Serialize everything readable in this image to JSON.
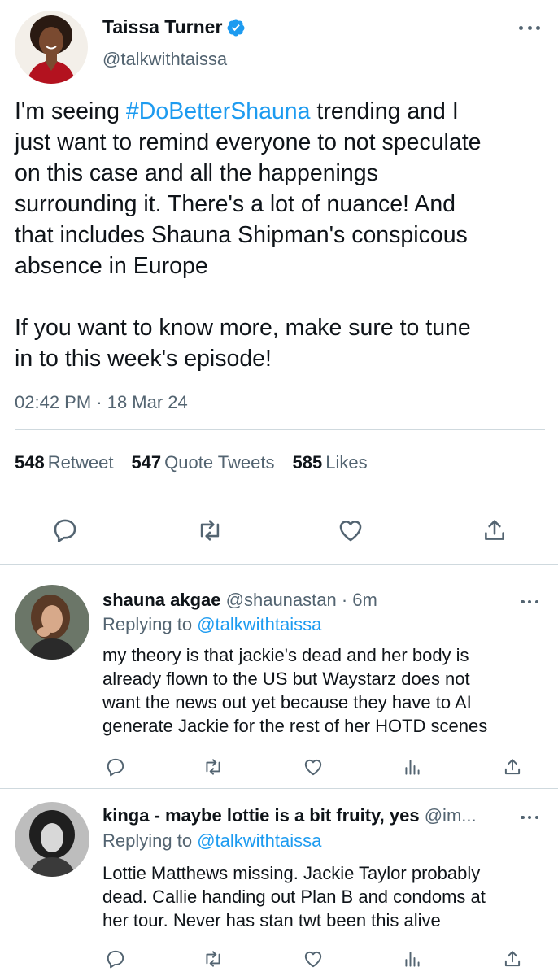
{
  "tweet": {
    "author_name": "Taissa Turner",
    "author_handle": "@talkwithtaissa",
    "text_lines": [
      [
        "I'm seeing ",
        "#DoBetterShauna",
        " trending and I"
      ],
      "just want to remind everyone to not speculate",
      "on this case and all the happenings",
      "surrounding it. There's a lot of nuance! And",
      "that includes Shauna Shipman's conspicous",
      "absence in Europe",
      "",
      "If you want to know more, make sure to tune",
      "in to this week's episode!"
    ],
    "text_parts": {
      "line1_pre": "I'm seeing ",
      "hashtag": "#DoBetterShauna",
      "line1_post": " trending and I",
      "line2": "just want to remind everyone to not speculate",
      "line3": "on this case and all the happenings",
      "line4": "surrounding it. There's a lot of nuance! And",
      "line5": "that includes Shauna Shipman's conspicous",
      "line6": "absence in Europe",
      "line7": "If you want to know more, make sure to tune",
      "line8": "in to this week's episode!"
    },
    "timestamp": "02:42 PM · 18 Mar 24",
    "stats": {
      "retweets": "548",
      "retweets_label": "Retweet",
      "quotes": "547",
      "quotes_label": "Quote Tweets",
      "likes": "585",
      "likes_label": "Likes"
    },
    "icons": [
      "reply-icon",
      "retweet-icon",
      "like-icon",
      "share-icon"
    ]
  },
  "replies": [
    {
      "name": "shauna akgae",
      "handle": "@shaunastan",
      "time": "· 6m",
      "replying_prefix": "Replying to",
      "replying_to": "@talkwithtaissa",
      "lines": [
        "my theory is that jackie's dead and her body is",
        "already flown to the US but Waystarz does not",
        "want the news out yet because they have to AI",
        "generate Jackie for the rest of her HOTD scenes"
      ]
    },
    {
      "name": "kinga - maybe lottie is a bit fruity, yes",
      "handle": "@im...",
      "time": "",
      "replying_prefix": "Replying to",
      "replying_to": "@talkwithtaissa",
      "lines": [
        "Lottie Matthews missing. Jackie Taylor probably",
        "dead. Callie handing out Plan B and condoms at",
        "her tour. Never has stan twt been this alive"
      ]
    }
  ],
  "colors": {
    "accent": "#1d9bf0",
    "secondary_text": "#536471",
    "divider": "#cfd9de",
    "like_icon_red": "#c8102e"
  }
}
